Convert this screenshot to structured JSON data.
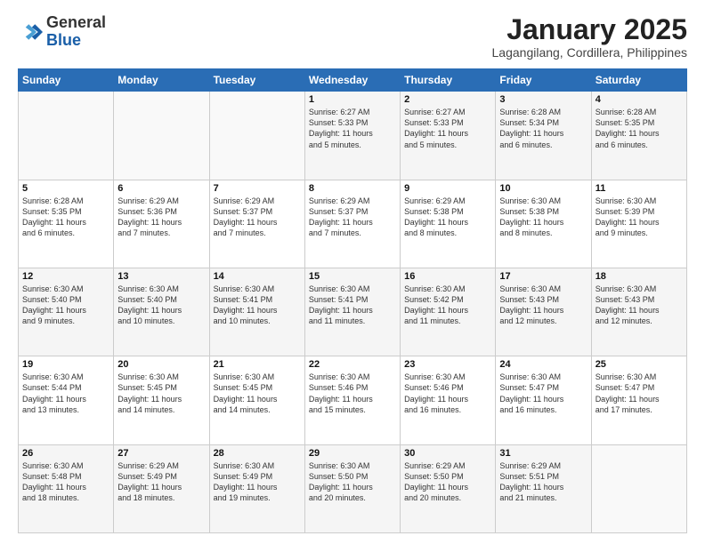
{
  "header": {
    "logo_general": "General",
    "logo_blue": "Blue",
    "month_title": "January 2025",
    "subtitle": "Lagangilang, Cordillera, Philippines"
  },
  "days_of_week": [
    "Sunday",
    "Monday",
    "Tuesday",
    "Wednesday",
    "Thursday",
    "Friday",
    "Saturday"
  ],
  "weeks": [
    [
      {
        "day": "",
        "info": ""
      },
      {
        "day": "",
        "info": ""
      },
      {
        "day": "",
        "info": ""
      },
      {
        "day": "1",
        "info": "Sunrise: 6:27 AM\nSunset: 5:33 PM\nDaylight: 11 hours\nand 5 minutes."
      },
      {
        "day": "2",
        "info": "Sunrise: 6:27 AM\nSunset: 5:33 PM\nDaylight: 11 hours\nand 5 minutes."
      },
      {
        "day": "3",
        "info": "Sunrise: 6:28 AM\nSunset: 5:34 PM\nDaylight: 11 hours\nand 6 minutes."
      },
      {
        "day": "4",
        "info": "Sunrise: 6:28 AM\nSunset: 5:35 PM\nDaylight: 11 hours\nand 6 minutes."
      }
    ],
    [
      {
        "day": "5",
        "info": "Sunrise: 6:28 AM\nSunset: 5:35 PM\nDaylight: 11 hours\nand 6 minutes."
      },
      {
        "day": "6",
        "info": "Sunrise: 6:29 AM\nSunset: 5:36 PM\nDaylight: 11 hours\nand 7 minutes."
      },
      {
        "day": "7",
        "info": "Sunrise: 6:29 AM\nSunset: 5:37 PM\nDaylight: 11 hours\nand 7 minutes."
      },
      {
        "day": "8",
        "info": "Sunrise: 6:29 AM\nSunset: 5:37 PM\nDaylight: 11 hours\nand 7 minutes."
      },
      {
        "day": "9",
        "info": "Sunrise: 6:29 AM\nSunset: 5:38 PM\nDaylight: 11 hours\nand 8 minutes."
      },
      {
        "day": "10",
        "info": "Sunrise: 6:30 AM\nSunset: 5:38 PM\nDaylight: 11 hours\nand 8 minutes."
      },
      {
        "day": "11",
        "info": "Sunrise: 6:30 AM\nSunset: 5:39 PM\nDaylight: 11 hours\nand 9 minutes."
      }
    ],
    [
      {
        "day": "12",
        "info": "Sunrise: 6:30 AM\nSunset: 5:40 PM\nDaylight: 11 hours\nand 9 minutes."
      },
      {
        "day": "13",
        "info": "Sunrise: 6:30 AM\nSunset: 5:40 PM\nDaylight: 11 hours\nand 10 minutes."
      },
      {
        "day": "14",
        "info": "Sunrise: 6:30 AM\nSunset: 5:41 PM\nDaylight: 11 hours\nand 10 minutes."
      },
      {
        "day": "15",
        "info": "Sunrise: 6:30 AM\nSunset: 5:41 PM\nDaylight: 11 hours\nand 11 minutes."
      },
      {
        "day": "16",
        "info": "Sunrise: 6:30 AM\nSunset: 5:42 PM\nDaylight: 11 hours\nand 11 minutes."
      },
      {
        "day": "17",
        "info": "Sunrise: 6:30 AM\nSunset: 5:43 PM\nDaylight: 11 hours\nand 12 minutes."
      },
      {
        "day": "18",
        "info": "Sunrise: 6:30 AM\nSunset: 5:43 PM\nDaylight: 11 hours\nand 12 minutes."
      }
    ],
    [
      {
        "day": "19",
        "info": "Sunrise: 6:30 AM\nSunset: 5:44 PM\nDaylight: 11 hours\nand 13 minutes."
      },
      {
        "day": "20",
        "info": "Sunrise: 6:30 AM\nSunset: 5:45 PM\nDaylight: 11 hours\nand 14 minutes."
      },
      {
        "day": "21",
        "info": "Sunrise: 6:30 AM\nSunset: 5:45 PM\nDaylight: 11 hours\nand 14 minutes."
      },
      {
        "day": "22",
        "info": "Sunrise: 6:30 AM\nSunset: 5:46 PM\nDaylight: 11 hours\nand 15 minutes."
      },
      {
        "day": "23",
        "info": "Sunrise: 6:30 AM\nSunset: 5:46 PM\nDaylight: 11 hours\nand 16 minutes."
      },
      {
        "day": "24",
        "info": "Sunrise: 6:30 AM\nSunset: 5:47 PM\nDaylight: 11 hours\nand 16 minutes."
      },
      {
        "day": "25",
        "info": "Sunrise: 6:30 AM\nSunset: 5:47 PM\nDaylight: 11 hours\nand 17 minutes."
      }
    ],
    [
      {
        "day": "26",
        "info": "Sunrise: 6:30 AM\nSunset: 5:48 PM\nDaylight: 11 hours\nand 18 minutes."
      },
      {
        "day": "27",
        "info": "Sunrise: 6:29 AM\nSunset: 5:49 PM\nDaylight: 11 hours\nand 18 minutes."
      },
      {
        "day": "28",
        "info": "Sunrise: 6:30 AM\nSunset: 5:49 PM\nDaylight: 11 hours\nand 19 minutes."
      },
      {
        "day": "29",
        "info": "Sunrise: 6:30 AM\nSunset: 5:50 PM\nDaylight: 11 hours\nand 20 minutes."
      },
      {
        "day": "30",
        "info": "Sunrise: 6:29 AM\nSunset: 5:50 PM\nDaylight: 11 hours\nand 20 minutes."
      },
      {
        "day": "31",
        "info": "Sunrise: 6:29 AM\nSunset: 5:51 PM\nDaylight: 11 hours\nand 21 minutes."
      },
      {
        "day": "",
        "info": ""
      }
    ]
  ]
}
